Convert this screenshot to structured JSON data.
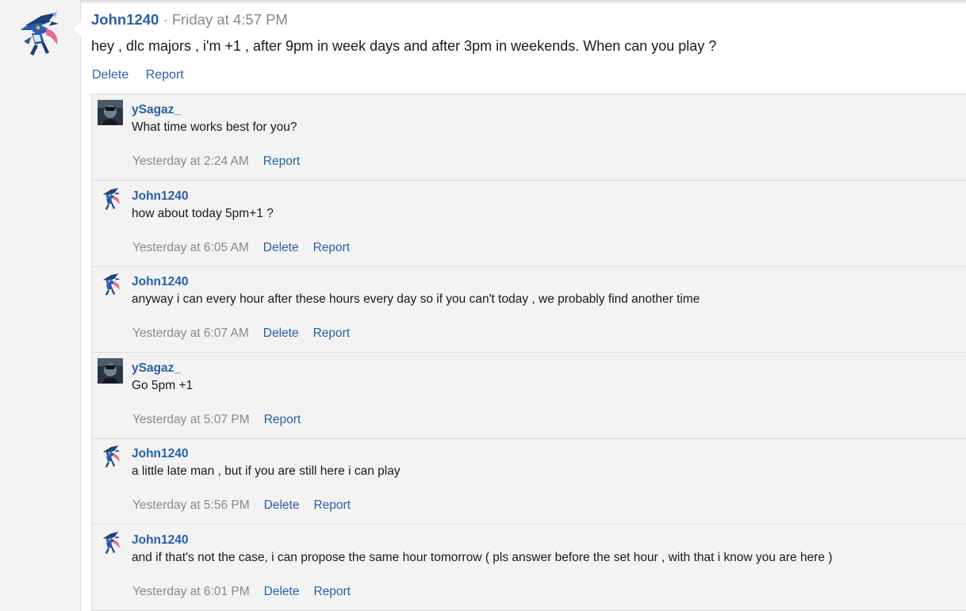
{
  "post": {
    "author": "John1240",
    "separator": "·",
    "time": "Friday at 4:57 PM",
    "text": "hey , dlc majors , i'm +1 , after 9pm in week days and after 3pm in weekends. When can you play ?",
    "actions": {
      "delete": "Delete",
      "report": "Report"
    }
  },
  "comments": [
    {
      "author": "ySagaz_",
      "avatar": "ysagaz-avatar",
      "text": "What time works best for you?",
      "time": "Yesterday at 2:24 AM",
      "delete": "",
      "report": "Report"
    },
    {
      "author": "John1240",
      "avatar": "john1240-avatar",
      "text": "how about today 5pm+1 ?",
      "time": "Yesterday at 6:05 AM",
      "delete": "Delete",
      "report": "Report"
    },
    {
      "author": "John1240",
      "avatar": "john1240-avatar",
      "text": "anyway i can every hour after these hours every day so if you can't today , we probably find another time",
      "time": "Yesterday at 6:07 AM",
      "delete": "Delete",
      "report": "Report"
    },
    {
      "author": "ySagaz_",
      "avatar": "ysagaz-avatar",
      "text": "Go 5pm +1",
      "time": "Yesterday at 5:07 PM",
      "delete": "",
      "report": "Report"
    },
    {
      "author": "John1240",
      "avatar": "john1240-avatar",
      "text": "a little late man , but if you are still here i can play",
      "time": "Yesterday at 5:56 PM",
      "delete": "Delete",
      "report": "Report"
    },
    {
      "author": "John1240",
      "avatar": "john1240-avatar",
      "text": "and if that's not the case, i can propose the same hour tomorrow ( pls answer before the set hour , with that i know you are here )",
      "time": "Yesterday at 6:01 PM",
      "delete": "Delete",
      "report": "Report"
    }
  ],
  "colors": {
    "link": "#2a5fa8",
    "muted": "#8a8a8a",
    "panel": "#f3f3f3"
  }
}
